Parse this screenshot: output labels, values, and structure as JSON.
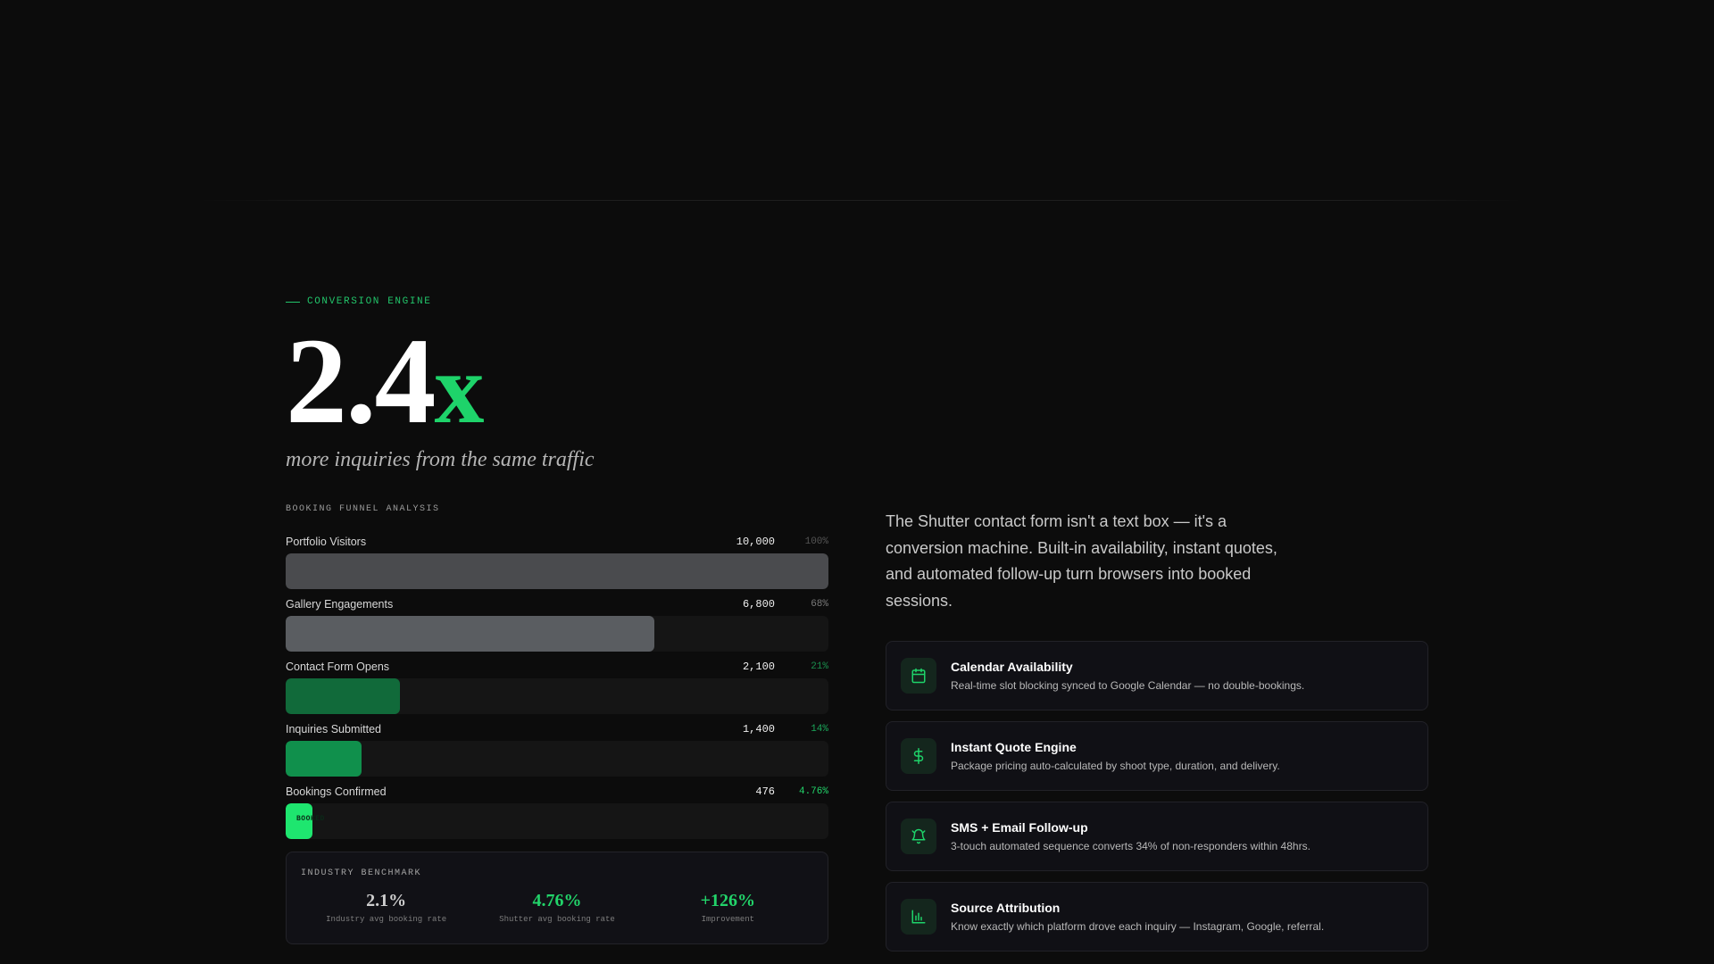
{
  "section": {
    "eyebrow": "CONVERSION ENGINE",
    "headline_number": "2.4",
    "headline_suffix": "x",
    "subhead": "more inquiries from the same traffic"
  },
  "funnel": {
    "title": "BOOKING FUNNEL ANALYSIS",
    "stages": [
      {
        "label": "Portfolio Visitors",
        "count": "10,000",
        "pct": "100%",
        "fill_fraction": 1.0,
        "color": "#4a4b4e",
        "pct_color": "#555555"
      },
      {
        "label": "Gallery Engagements",
        "count": "6,800",
        "pct": "68%",
        "fill_fraction": 0.68,
        "color": "#5a5d61",
        "pct_color": "#7a7a7a"
      },
      {
        "label": "Contact Form Opens",
        "count": "2,100",
        "pct": "21%",
        "fill_fraction": 0.21,
        "color": "#116a3a",
        "pct_color": "#1a8c4c"
      },
      {
        "label": "Inquiries Submitted",
        "count": "1,400",
        "pct": "14%",
        "fill_fraction": 0.14,
        "color": "#10904c",
        "pct_color": "#1ba75a"
      },
      {
        "label": "Bookings Confirmed",
        "count": "476",
        "pct": "4.76%",
        "fill_fraction": 0.0476,
        "color": "#1ee66f",
        "pct_color": "#22d46a",
        "tag": "BOOKED"
      }
    ]
  },
  "benchmark": {
    "title": "INDUSTRY BENCHMARK",
    "items": [
      {
        "value": "2.1%",
        "label": "Industry avg booking rate",
        "color": "#cfcfcf"
      },
      {
        "value": "4.76%",
        "label": "Shutter avg booking rate",
        "color": "#22d46a"
      },
      {
        "value": "+126%",
        "label": "Improvement",
        "color": "#22d46a"
      }
    ]
  },
  "intro": "The Shutter contact form isn't a text box — it's a conversion machine. Built-in availability, instant quotes, and automated follow-up turn browsers into booked sessions.",
  "features": [
    {
      "icon": "calendar-icon",
      "title": "Calendar Availability",
      "desc": "Real-time slot blocking synced to Google Calendar — no double-bookings."
    },
    {
      "icon": "dollar-icon",
      "title": "Instant Quote Engine",
      "desc": "Package pricing auto-calculated by shoot type, duration, and delivery."
    },
    {
      "icon": "bell-icon",
      "title": "SMS + Email Follow-up",
      "desc": "3-touch automated sequence converts 34% of non-responders within 48hrs."
    },
    {
      "icon": "bar-chart-icon",
      "title": "Source Attribution",
      "desc": "Know exactly which platform drove each inquiry — Instagram, Google, referral."
    }
  ],
  "colors": {
    "accent": "#1ed36a",
    "background": "#0c0c0c",
    "card": "#101015"
  }
}
